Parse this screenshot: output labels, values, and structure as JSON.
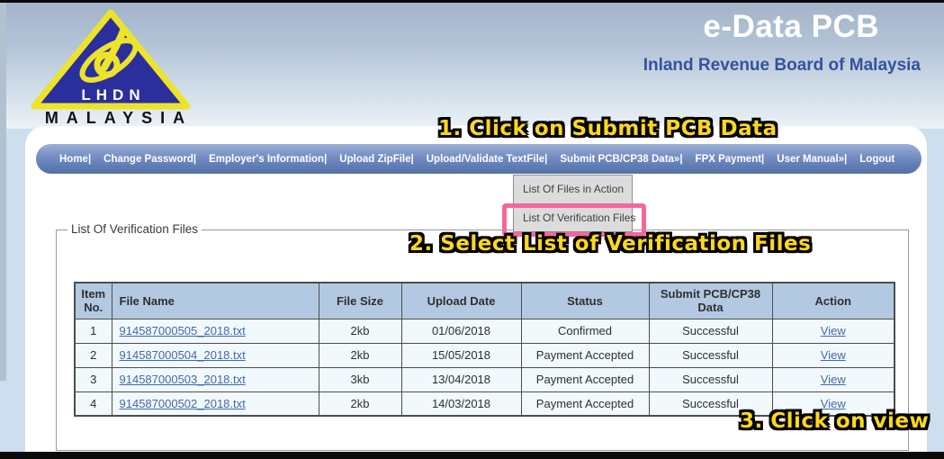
{
  "page": {
    "app_title": "e-Data PCB",
    "org_name": "Inland Revenue Board of Malaysia"
  },
  "logo": {
    "acronym": "LHDN",
    "country": "MALAYSIA"
  },
  "nav": {
    "items": [
      "Home|",
      "Change Password|",
      "Employer's Information|",
      "Upload ZipFile|",
      "Upload/Validate TextFile|",
      "Submit PCB/CP38 Data»|",
      "FPX Payment|",
      "User Manual»|",
      "Logout"
    ]
  },
  "dropdown": {
    "items": [
      "List Of Files in Action",
      "List Of Verification Files"
    ]
  },
  "annotations": {
    "step1": "1. Click on Submit PCB Data",
    "step2": "2. Select List of Verification Files",
    "step3": "3. Click on view"
  },
  "section": {
    "legend": "List Of Verification Files"
  },
  "table": {
    "headers": [
      "Item No.",
      "File Name",
      "File Size",
      "Upload Date",
      "Status",
      "Submit PCB/CP38 Data",
      "Action"
    ],
    "rows": [
      {
        "item_no": "1",
        "file_name": "914587000505_2018.txt",
        "file_size": "2kb",
        "upload_date": "01/06/2018",
        "status": "Confirmed",
        "submit_data": "Successful",
        "action": "View"
      },
      {
        "item_no": "2",
        "file_name": "914587000504_2018.txt",
        "file_size": "2kb",
        "upload_date": "15/05/2018",
        "status": "Payment Accepted",
        "submit_data": "Successful",
        "action": "View"
      },
      {
        "item_no": "3",
        "file_name": "914587000503_2018.txt",
        "file_size": "3kb",
        "upload_date": "13/04/2018",
        "status": "Payment Accepted",
        "submit_data": "Successful",
        "action": "View"
      },
      {
        "item_no": "4",
        "file_name": "914587000502_2018.txt",
        "file_size": "2kb",
        "upload_date": "14/03/2018",
        "status": "Payment Accepted",
        "submit_data": "Successful",
        "action": "View"
      }
    ]
  },
  "colors": {
    "annotation_yellow": "#ffd71e",
    "highlight_pink": "#f4679d",
    "nav_blue": "#5f7cb6",
    "link_blue": "#4468ad",
    "table_header_bg": "#b3c9e2",
    "org_title_blue": "#33539e",
    "logo_triangle_blue": "#2b2f9e",
    "logo_yellow": "#ede32b"
  }
}
